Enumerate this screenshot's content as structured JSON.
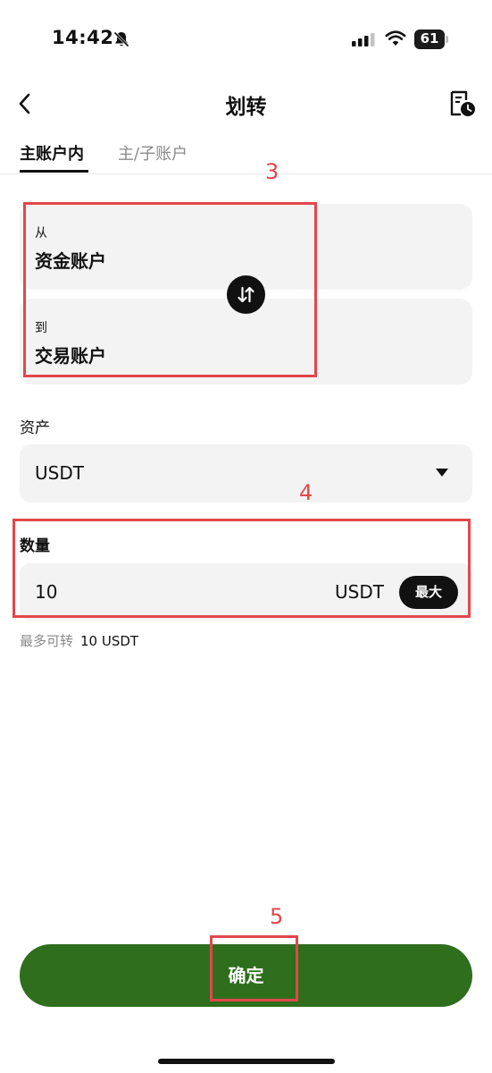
{
  "status_bar": {
    "time": "14:42",
    "battery": "61"
  },
  "header": {
    "title": "划转"
  },
  "tabs": [
    {
      "label": "主账户内",
      "active": true
    },
    {
      "label": "主/子账户",
      "active": false
    }
  ],
  "transfer": {
    "from_label": "从",
    "from_account": "资金账户",
    "to_label": "到",
    "to_account": "交易账户"
  },
  "asset": {
    "label": "资产",
    "value": "USDT"
  },
  "quantity": {
    "label": "数量",
    "value": "10",
    "unit": "USDT",
    "max_label": "最大"
  },
  "available": {
    "label": "最多可转",
    "value": "10 USDT"
  },
  "confirm_label": "确定",
  "annotations": [
    "3",
    "4",
    "5"
  ],
  "colors": {
    "primary": "#2e6e1c",
    "annotation": "#e2474b",
    "card": "#f3f3f3"
  }
}
